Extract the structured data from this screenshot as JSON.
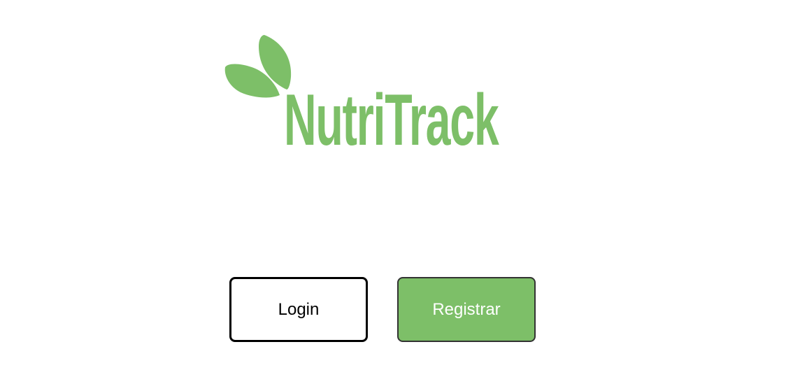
{
  "logo": {
    "text": "NutriTrack",
    "leaf_icon": "leaves-icon",
    "brand_color": "#7dbf68"
  },
  "buttons": {
    "login_label": "Login",
    "register_label": "Registrar"
  },
  "colors": {
    "background": "#ffffff",
    "accent": "#7dbf68",
    "login_border": "#000000",
    "register_text": "#ffffff"
  }
}
